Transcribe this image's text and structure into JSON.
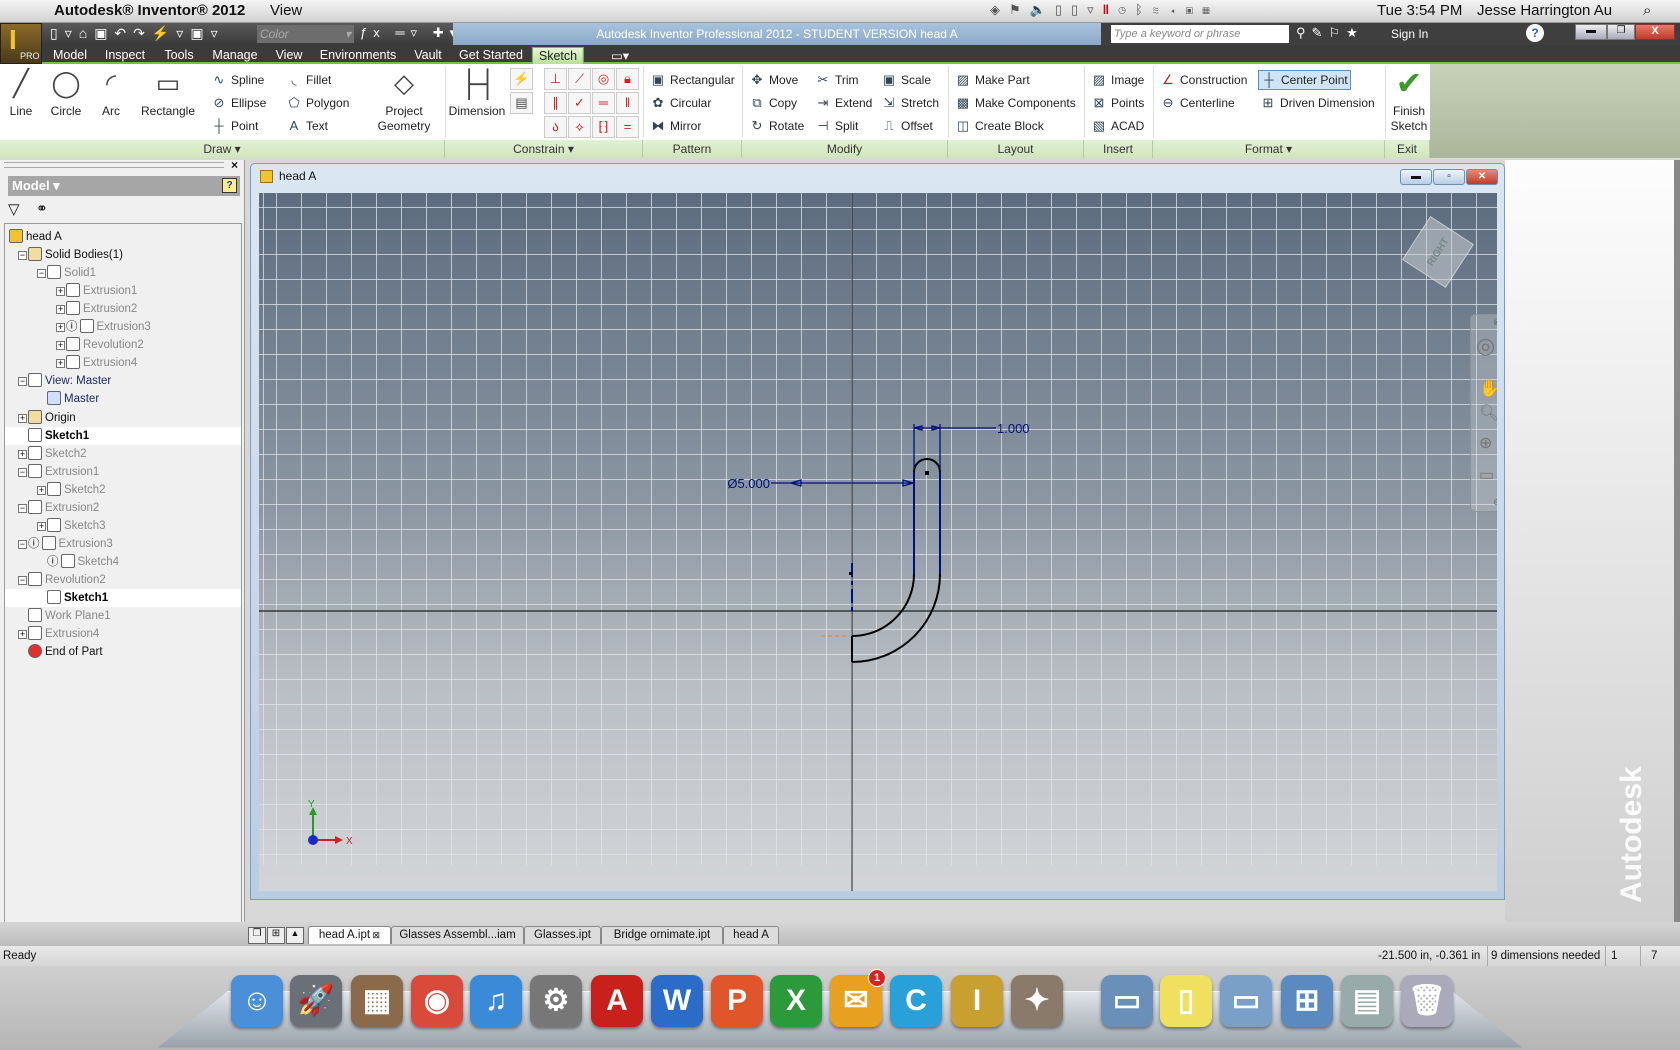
{
  "mac_menubar": {
    "app_name": "Autodesk® Inventor® 2012",
    "menus": [
      "View"
    ],
    "clock": "Tue 3:54 PM",
    "user": "Jesse Harrington Au",
    "status_icons": [
      "dropbox-icon",
      "flag-icon",
      "volume-icon",
      "device-icon",
      "plug-icon",
      "triangle-menu-icon",
      "parallels-icon",
      "time-machine-icon",
      "bluetooth-icon",
      "wifi-icon",
      "speaker-icon",
      "battery-icon",
      "calculator-icon",
      "spotlight-icon"
    ]
  },
  "app": {
    "title": "Autodesk Inventor Professional 2012 - STUDENT VERSION    head A",
    "app_button_badge": "PRO",
    "color_combo": "Color",
    "search_placeholder": "Type a keyword or phrase",
    "sign_in": "Sign In",
    "help": "?"
  },
  "ribbon_tabs": [
    {
      "label": "Model"
    },
    {
      "label": "Inspect"
    },
    {
      "label": "Tools"
    },
    {
      "label": "Manage"
    },
    {
      "label": "View"
    },
    {
      "label": "Environments"
    },
    {
      "label": "Vault"
    },
    {
      "label": "Get Started"
    },
    {
      "label": "Sketch",
      "active": true
    }
  ],
  "ribbon": {
    "panels": [
      {
        "label": "Draw ▾"
      },
      {
        "label": "Constrain ▾"
      },
      {
        "label": "Pattern"
      },
      {
        "label": "Modify"
      },
      {
        "label": "Layout"
      },
      {
        "label": "Insert"
      },
      {
        "label": "Format ▾"
      },
      {
        "label": "Exit"
      }
    ],
    "large_buttons": [
      {
        "label": "Line",
        "icon": "line-icon"
      },
      {
        "label": "Circle",
        "icon": "circle-icon"
      },
      {
        "label": "Arc",
        "icon": "arc-icon"
      },
      {
        "label": "Rectangle",
        "icon": "rectangle-icon"
      },
      {
        "label": "Project Geometry",
        "icon": "project-geometry-icon"
      },
      {
        "label": "Dimension",
        "icon": "dimension-icon"
      },
      {
        "label": "Finish Sketch",
        "icon": "checkmark-icon"
      }
    ],
    "small_buttons": [
      {
        "label": "Spline",
        "icon": "spline-icon"
      },
      {
        "label": "Ellipse",
        "icon": "ellipse-icon"
      },
      {
        "label": "Point",
        "icon": "point-icon"
      },
      {
        "label": "Fillet",
        "icon": "fillet-icon"
      },
      {
        "label": "Polygon",
        "icon": "polygon-icon"
      },
      {
        "label": "Text",
        "icon": "text-icon"
      },
      {
        "label": "Rectangular",
        "icon": "rectangular-pattern-icon"
      },
      {
        "label": "Circular",
        "icon": "circular-pattern-icon"
      },
      {
        "label": "Mirror",
        "icon": "mirror-icon"
      },
      {
        "label": "Move",
        "icon": "move-icon"
      },
      {
        "label": "Copy",
        "icon": "copy-icon"
      },
      {
        "label": "Rotate",
        "icon": "rotate-icon"
      },
      {
        "label": "Trim",
        "icon": "trim-icon"
      },
      {
        "label": "Extend",
        "icon": "extend-icon"
      },
      {
        "label": "Split",
        "icon": "split-icon"
      },
      {
        "label": "Scale",
        "icon": "scale-icon"
      },
      {
        "label": "Stretch",
        "icon": "stretch-icon"
      },
      {
        "label": "Offset",
        "icon": "offset-icon"
      },
      {
        "label": "Make Part",
        "icon": "make-part-icon"
      },
      {
        "label": "Make Components",
        "icon": "make-components-icon"
      },
      {
        "label": "Create Block",
        "icon": "create-block-icon"
      },
      {
        "label": "Image",
        "icon": "image-icon"
      },
      {
        "label": "Points",
        "icon": "points-icon"
      },
      {
        "label": "ACAD",
        "icon": "acad-icon"
      },
      {
        "label": "Construction",
        "icon": "construction-icon"
      },
      {
        "label": "Centerline",
        "icon": "centerline-icon"
      },
      {
        "label": "Center Point",
        "icon": "center-point-icon",
        "active": true
      },
      {
        "label": "Driven Dimension",
        "icon": "driven-dimension-icon"
      }
    ],
    "constraint_icons": [
      "perpendicular-icon",
      "tangent-icon",
      "concentric-icon",
      "fix-icon",
      "parallel-icon",
      "coincident-icon",
      "horizontal-icon",
      "vertical-icon",
      "smooth-icon",
      "symmetric-icon",
      "collinear-icon",
      "equal-icon"
    ],
    "dimension_side_icons": [
      "auto-dimension-icon",
      "show-constraints-icon"
    ]
  },
  "browser": {
    "title": "Model ▾",
    "tree": [
      {
        "label": "head A",
        "level": 0,
        "icon": "part-icon",
        "style": "dark"
      },
      {
        "label": "Solid Bodies(1)",
        "level": 1,
        "icon": "folder-icon",
        "style": "dark",
        "exp": "-"
      },
      {
        "label": "Solid1",
        "level": 2,
        "icon": "solid-icon",
        "exp": "-"
      },
      {
        "label": "Extrusion1",
        "level": 3,
        "icon": "extrusion-icon",
        "exp": "+"
      },
      {
        "label": "Extrusion2",
        "level": 3,
        "icon": "extrusion-icon",
        "exp": "+"
      },
      {
        "label": "Extrusion3",
        "level": 3,
        "icon": "extrusion-icon",
        "exp": "+",
        "info": true
      },
      {
        "label": "Revolution2",
        "level": 3,
        "icon": "revolution-icon",
        "exp": "+"
      },
      {
        "label": "Extrusion4",
        "level": 3,
        "icon": "extrusion-icon",
        "exp": "+"
      },
      {
        "label": "View: Master",
        "level": 1,
        "icon": "view-icon",
        "style": "navy",
        "exp": "-"
      },
      {
        "label": "Master",
        "level": 2,
        "icon": "checkbox-lock-icon",
        "style": "navy"
      },
      {
        "label": "Origin",
        "level": 1,
        "icon": "folder-icon",
        "style": "dark",
        "exp": "+"
      },
      {
        "label": "Sketch1",
        "level": 1,
        "icon": "sketch-icon",
        "selected": true
      },
      {
        "label": "Sketch2",
        "level": 1,
        "icon": "sketch-icon",
        "exp": "+"
      },
      {
        "label": "Extrusion1",
        "level": 1,
        "icon": "extrusion-icon",
        "exp": "-"
      },
      {
        "label": "Sketch2",
        "level": 2,
        "icon": "sketch-icon",
        "exp": "+"
      },
      {
        "label": "Extrusion2",
        "level": 1,
        "icon": "extrusion-icon",
        "exp": "-"
      },
      {
        "label": "Sketch3",
        "level": 2,
        "icon": "sketch-icon",
        "exp": "+"
      },
      {
        "label": "Extrusion3",
        "level": 1,
        "icon": "extrusion-icon",
        "exp": "-",
        "info": true
      },
      {
        "label": "Sketch4",
        "level": 2,
        "icon": "sketch-icon",
        "info": true
      },
      {
        "label": "Revolution2",
        "level": 1,
        "icon": "revolution-icon",
        "exp": "-"
      },
      {
        "label": "Sketch1",
        "level": 2,
        "icon": "sketch-icon",
        "selected": true
      },
      {
        "label": "Work Plane1",
        "level": 1,
        "icon": "work-plane-icon"
      },
      {
        "label": "Extrusion4",
        "level": 1,
        "icon": "extrusion-icon",
        "exp": "+"
      },
      {
        "label": "End of Part",
        "level": 1,
        "icon": "end-of-part-icon",
        "style": "dark"
      }
    ]
  },
  "document": {
    "title": "head A",
    "viewcube_face": "RIGHT",
    "dimensions": {
      "width": "1.000",
      "diameter": "Ø5.000"
    },
    "axis_x": "X",
    "axis_y": "Y",
    "watermark": "Autodesk"
  },
  "doc_tabs": [
    {
      "label": "head A.ipt",
      "active": true
    },
    {
      "label": "Glasses Assembl...iam"
    },
    {
      "label": "Glasses.ipt"
    },
    {
      "label": "Bridge ornimate.ipt"
    },
    {
      "label": "head A"
    }
  ],
  "status": {
    "left": "Ready",
    "coords": "-21.500 in, -0.361 in",
    "message": "9 dimensions needed",
    "count1": "1",
    "count2": "7"
  },
  "dock": [
    {
      "name": "finder",
      "color": "#4a8fd8",
      "glyph": "☺"
    },
    {
      "name": "launchpad",
      "color": "#6a6f78",
      "glyph": "🚀"
    },
    {
      "name": "photo-app",
      "color": "#8a6a4a",
      "glyph": "▦"
    },
    {
      "name": "chrome",
      "color": "#d94a3a",
      "glyph": "◉"
    },
    {
      "name": "itunes",
      "color": "#3a8ad8",
      "glyph": "♫"
    },
    {
      "name": "system-preferences",
      "color": "#777",
      "glyph": "⚙"
    },
    {
      "name": "acrobat",
      "color": "#c8201a",
      "glyph": "A"
    },
    {
      "name": "word",
      "color": "#2a6cc8",
      "glyph": "W"
    },
    {
      "name": "powerpoint",
      "color": "#e0552a",
      "glyph": "P"
    },
    {
      "name": "excel",
      "color": "#2a9a3a",
      "glyph": "X"
    },
    {
      "name": "outlook",
      "color": "#e8a020",
      "glyph": "✉",
      "badge": "1"
    },
    {
      "name": "c-app",
      "color": "#2aa0d8",
      "glyph": "C"
    },
    {
      "name": "inventor",
      "color": "#c8a030",
      "glyph": "I"
    },
    {
      "name": "rocket-app",
      "color": "#8a7a6a",
      "glyph": "✦"
    },
    {
      "name": "folder",
      "color": "#6a8fb8",
      "glyph": "▭"
    },
    {
      "name": "document",
      "color": "#f0e060",
      "glyph": "▯"
    },
    {
      "name": "folder",
      "color": "#7aa0c8",
      "glyph": "▭"
    },
    {
      "name": "windows",
      "color": "#5a8ac0",
      "glyph": "⊞"
    },
    {
      "name": "screenshots",
      "color": "#9aa",
      "glyph": "▤"
    },
    {
      "name": "trash",
      "color": "#aab",
      "glyph": "🗑"
    }
  ]
}
